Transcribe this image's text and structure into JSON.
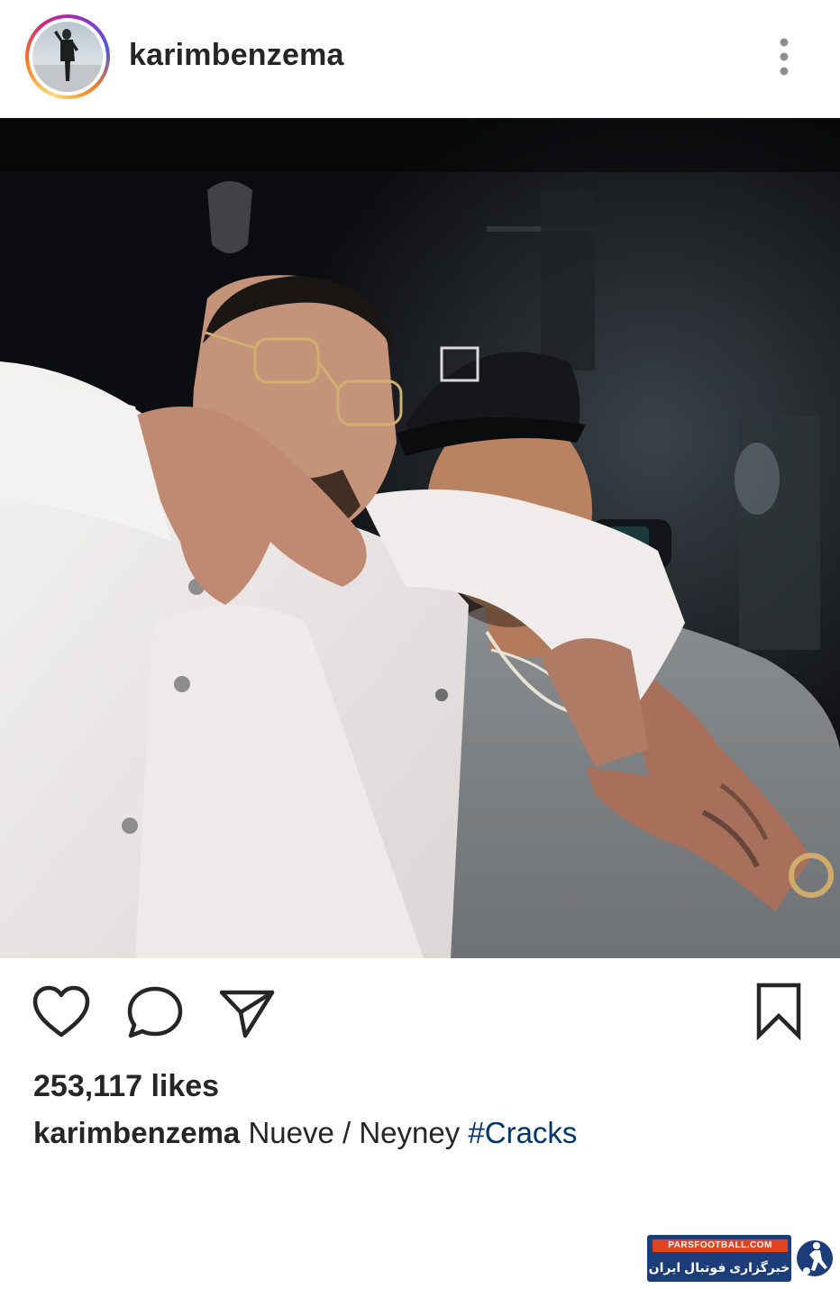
{
  "post": {
    "username": "karimbenzema",
    "likes_text": "253,117 likes",
    "caption": {
      "username": "karimbenzema",
      "text": " Nueve / Neyney ",
      "hashtag": "#Cracks"
    }
  },
  "icons": {
    "avatar": "profile-photo",
    "more": "more-vertical-icon",
    "like": "heart-icon",
    "comment": "comment-bubble-icon",
    "share": "paper-plane-icon",
    "save": "bookmark-icon"
  },
  "watermark": {
    "top_text": "PARSFOOTBALL.COM",
    "bottom_text": "خبرگزاری فوتبال ایران"
  },
  "colors": {
    "text": "#262626",
    "hashtag": "#003569",
    "watermark_blue": "#1c3d7a",
    "watermark_orange": "#e2431f"
  }
}
